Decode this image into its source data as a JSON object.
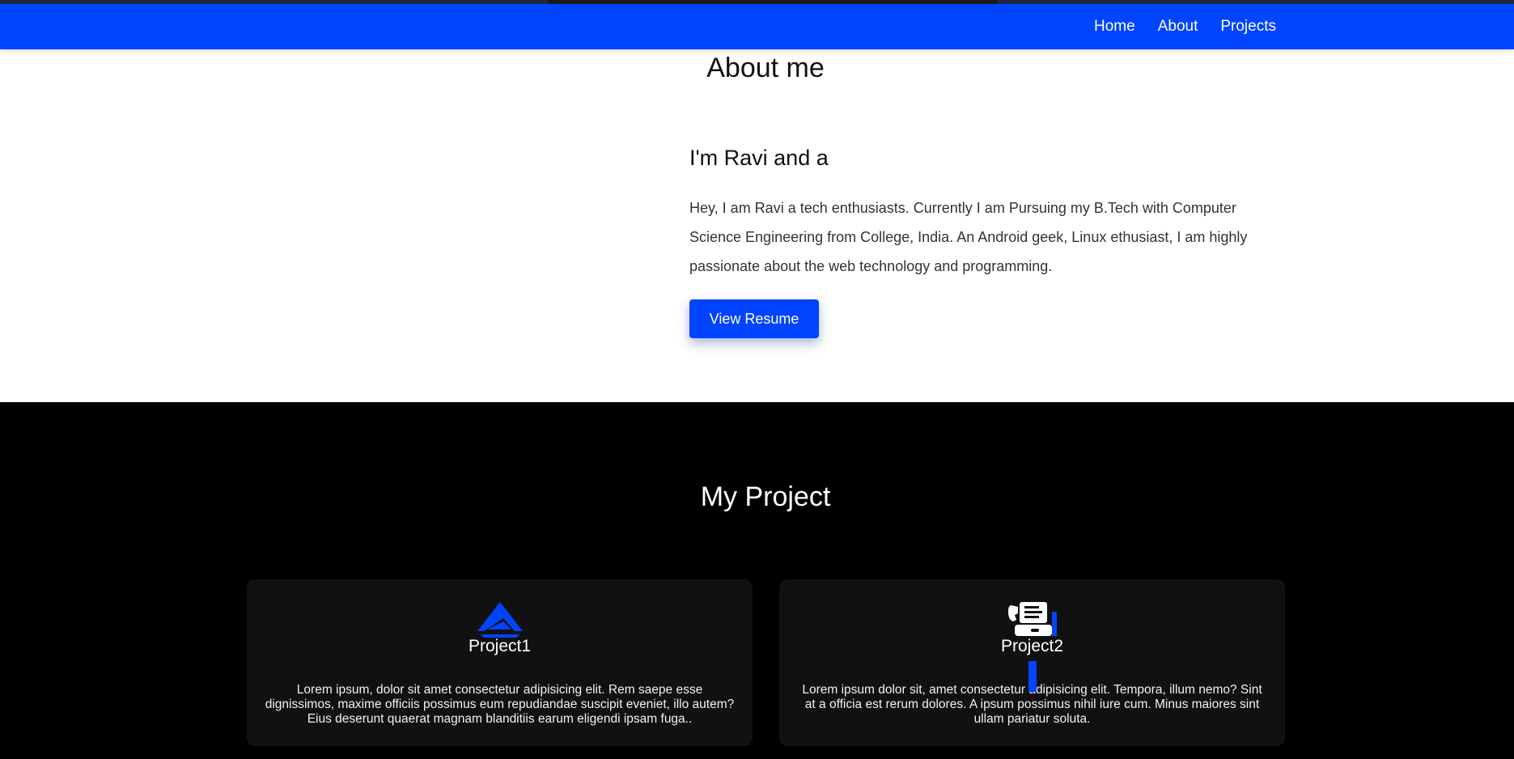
{
  "nav": {
    "items": [
      {
        "label": "Home"
      },
      {
        "label": "About"
      },
      {
        "label": "Projects"
      }
    ]
  },
  "about": {
    "title": "About me",
    "subtitle": "I'm Ravi and a",
    "paragraph": "Hey, I am Ravi a tech enthusiasts. Currently I am Pursuing my B.Tech with Computer Science Engineering from College, India. An Android geek, Linux ethusiast, I am highly passionate about the web technology and programming.",
    "button_label": "View Resume"
  },
  "projects": {
    "title": "My Project",
    "cards": [
      {
        "icon": "paper-plane-icon",
        "name": "Project1",
        "description": "Lorem ipsum, dolor sit amet consectetur adipisicing elit. Rem saepe esse dignissimos, maxime officiis possimus eum repudiandae suscipit eveniet, illo autem? Eius deserunt quaerat magnam blanditiis earum eligendi ipsam fuga.."
      },
      {
        "icon": "fax-machine-icon",
        "name": "Project2",
        "description": "Lorem ipsum dolor sit, amet consectetur adipisicing elit. Tempora, illum nemo? Sint at a officia est rerum dolores. A ipsum possimus nihil iure cum. Minus maiores sint ullam pariatur soluta."
      }
    ]
  },
  "colors": {
    "accent": "#0044ff",
    "dark_section": "#000000",
    "card_bg": "#111111"
  }
}
